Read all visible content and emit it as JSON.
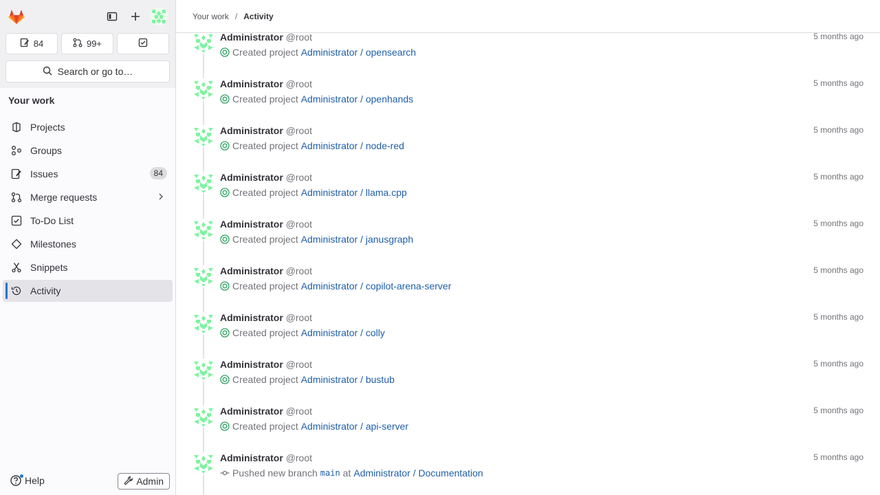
{
  "sidebar": {
    "counts": [
      {
        "value": "84",
        "icon": "issues-icon"
      },
      {
        "value": "99+",
        "icon": "merge-request-icon"
      },
      {
        "value": "",
        "icon": "todo-icon"
      }
    ],
    "search_label": "Search or go to…",
    "section_title": "Your work",
    "items": [
      {
        "label": "Projects",
        "icon": "project-icon"
      },
      {
        "label": "Groups",
        "icon": "group-icon"
      },
      {
        "label": "Issues",
        "icon": "issues-icon",
        "badge": "84"
      },
      {
        "label": "Merge requests",
        "icon": "merge-request-icon"
      },
      {
        "label": "To-Do List",
        "icon": "todo-icon"
      },
      {
        "label": "Milestones",
        "icon": "milestone-icon"
      },
      {
        "label": "Snippets",
        "icon": "snippet-icon"
      },
      {
        "label": "Activity",
        "icon": "history-icon",
        "active": true
      }
    ],
    "help_label": "Help",
    "admin_label": "Admin"
  },
  "breadcrumb": {
    "parent": "Your work",
    "current": "Activity"
  },
  "events": [
    {
      "name": "Administrator",
      "username": "@root",
      "time": "5 months ago",
      "action": "Created project",
      "target": "Administrator / opensearch"
    },
    {
      "name": "Administrator",
      "username": "@root",
      "time": "5 months ago",
      "action": "Created project",
      "target": "Administrator / openhands"
    },
    {
      "name": "Administrator",
      "username": "@root",
      "time": "5 months ago",
      "action": "Created project",
      "target": "Administrator / node-red"
    },
    {
      "name": "Administrator",
      "username": "@root",
      "time": "5 months ago",
      "action": "Created project",
      "target": "Administrator / llama.cpp"
    },
    {
      "name": "Administrator",
      "username": "@root",
      "time": "5 months ago",
      "action": "Created project",
      "target": "Administrator / janusgraph"
    },
    {
      "name": "Administrator",
      "username": "@root",
      "time": "5 months ago",
      "action": "Created project",
      "target": "Administrator / copilot-arena-server"
    },
    {
      "name": "Administrator",
      "username": "@root",
      "time": "5 months ago",
      "action": "Created project",
      "target": "Administrator / colly"
    },
    {
      "name": "Administrator",
      "username": "@root",
      "time": "5 months ago",
      "action": "Created project",
      "target": "Administrator / bustub"
    },
    {
      "name": "Administrator",
      "username": "@root",
      "time": "5 months ago",
      "action": "Created project",
      "target": "Administrator / api-server"
    },
    {
      "name": "Administrator",
      "username": "@root",
      "time": "5 months ago",
      "action": "Pushed new branch",
      "branch": "main",
      "connector": "at",
      "target": "Administrator / Documentation"
    }
  ],
  "colors": {
    "accent": "#1f75cb",
    "link": "#1f5fa8",
    "created_icon": "#2da160",
    "avatar_green": "#7af59e"
  }
}
